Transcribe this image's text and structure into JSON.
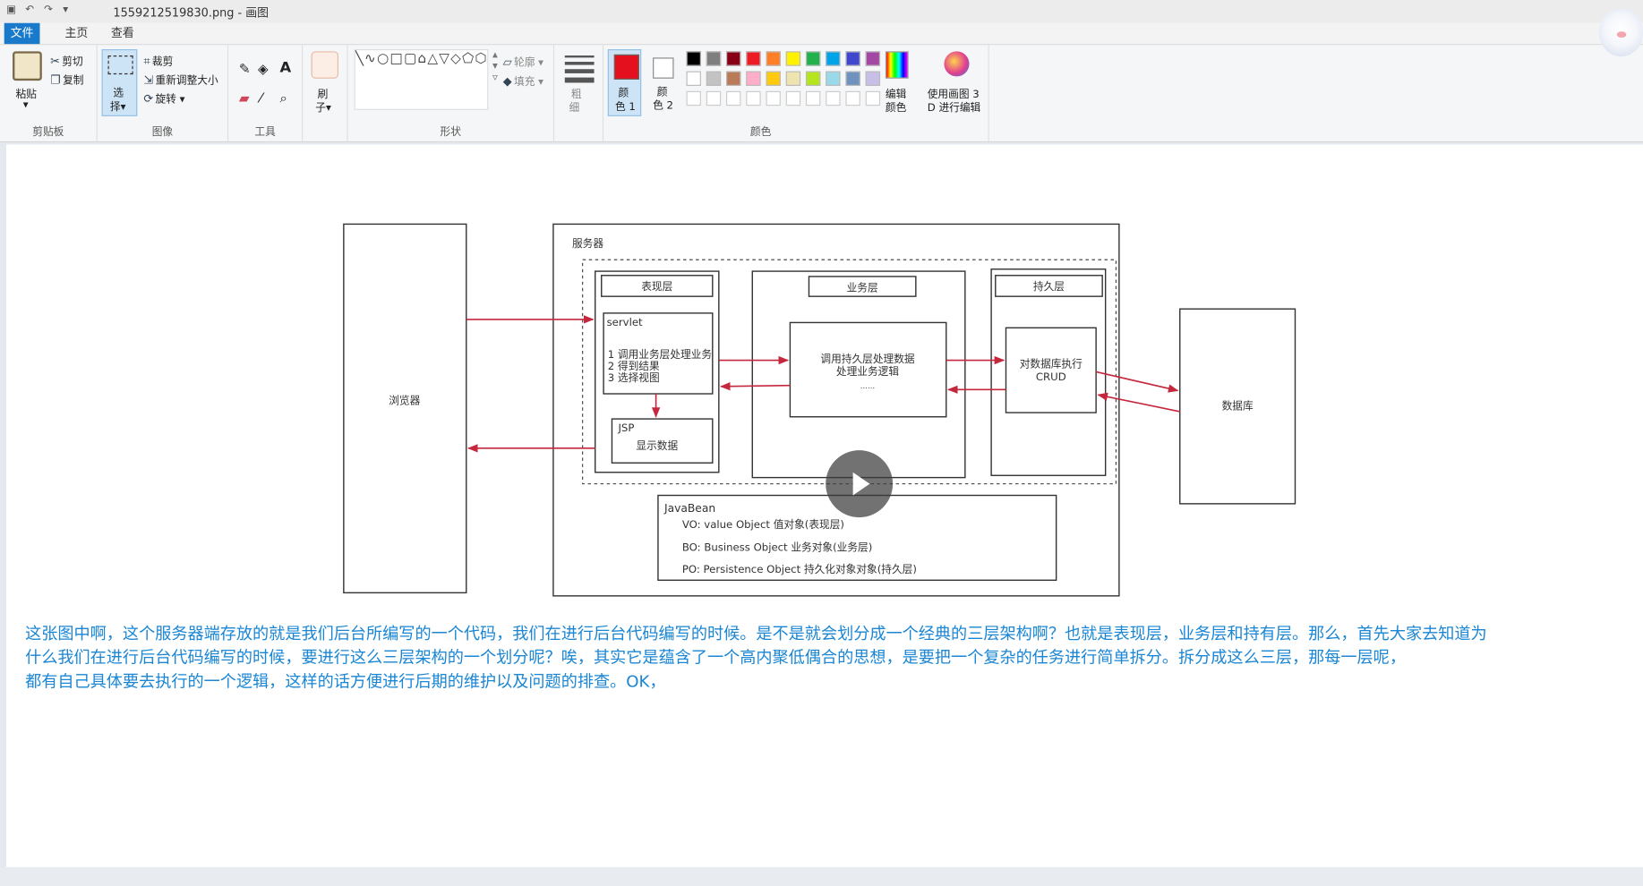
{
  "window": {
    "title": "1559212519830.png - 画图"
  },
  "menu": {
    "file": "文件",
    "home": "主页",
    "view": "查看"
  },
  "ribbon": {
    "clipboard": {
      "paste": "粘贴",
      "cut": "剪切",
      "copy": "复制",
      "label": "剪贴板"
    },
    "image": {
      "select_1": "选",
      "select_2": "择",
      "crop": "裁剪",
      "resize": "重新调整大小",
      "rotate": "旋转",
      "label": "图像"
    },
    "tools": {
      "label": "工具"
    },
    "brushes": {
      "label_1": "刷",
      "label_2": "子"
    },
    "shapes": {
      "outline": "轮廓",
      "fill": "填充",
      "label": "形状"
    },
    "size": {
      "label_1": "粗",
      "label_2": "细"
    },
    "color1": {
      "label_1": "颜",
      "label_2": "色 1"
    },
    "color2": {
      "label_1": "颜",
      "label_2": "色 2"
    },
    "edit_colors": {
      "label_1": "编辑",
      "label_2": "颜色"
    },
    "paint3d": {
      "label_1": "使用画图 3",
      "label_2": "D 进行编辑"
    },
    "colors_label": "颜色",
    "palette": [
      "#000000",
      "#7f7f7f",
      "#880015",
      "#ed1c24",
      "#ff7f27",
      "#fff200",
      "#22b14c",
      "#00a2e8",
      "#3f48cc",
      "#a349a4",
      "#ffffff",
      "#c3c3c3",
      "#b97a57",
      "#ffaec9",
      "#ffc90e",
      "#efe4b0",
      "#b5e61d",
      "#99d9ea",
      "#7092be",
      "#c8bfe7"
    ],
    "color1_value": "#e5101d"
  },
  "diagram": {
    "browser": "浏览器",
    "server": "服务器",
    "presentation": "表现层",
    "servlet": "servlet",
    "servlet_lines": [
      "1 调用业务层处理业务",
      "2 得到结果",
      "3 选择视图"
    ],
    "jsp": "JSP",
    "jsp_text": "显示数据",
    "business": "业务层",
    "business_lines": [
      "调用持久层处理数据",
      "处理业务逻辑"
    ],
    "business_dots": "……",
    "persistence": "持久层",
    "persistence_lines": [
      "对数据库执行",
      "CRUD"
    ],
    "database": "数据库",
    "javabean": "JavaBean",
    "javabean_lines": [
      "VO: value Object  值对象(表现层)",
      "BO: Business Object  业务对象(业务层)",
      "PO: Persistence Object  持久化对象对象(持久层)"
    ]
  },
  "caption": {
    "line1": "这张图中啊，这个服务器端存放的就是我们后台所编写的一个代码，我们在进行后台代码编写的时候。是不是就会划分成一个经典的三层架构啊？也就是表现层，业务层和持有层。那么，首先大家去知道为",
    "line2": "什么我们在进行后台代码编写的时候，要进行这么三层架构的一个划分呢？唉，其实它是蕴含了一个高内聚低偶合的思想，是要把一个复杂的任务进行简单拆分。拆分成这么三层，那每一层呢，",
    "line3": "都有自己具体要去执行的一个逻辑，这样的话方便进行后期的维护以及问题的排查。OK，"
  },
  "colors": {
    "caption": "#1a86d4",
    "arrow": "#c5283d",
    "accent": "#1979ca"
  },
  "icons": {
    "play": "play-icon"
  }
}
